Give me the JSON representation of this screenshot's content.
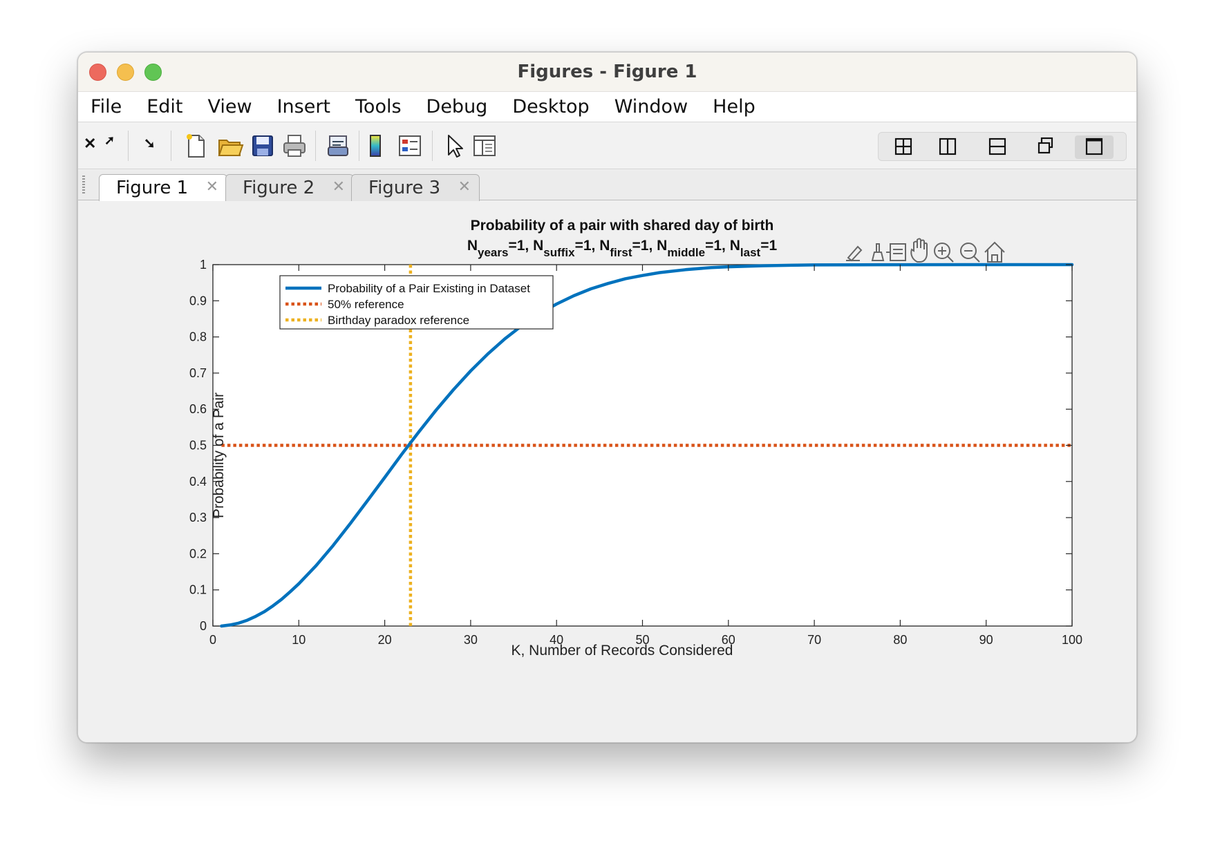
{
  "window": {
    "title": "Figures - Figure 1"
  },
  "menu": [
    "File",
    "Edit",
    "View",
    "Insert",
    "Tools",
    "Debug",
    "Desktop",
    "Window",
    "Help"
  ],
  "toolbar": {
    "close_glyph": "✕",
    "undock_glyph": "➚",
    "dock_glyph": "➘",
    "icons": [
      "new-figure-icon",
      "open-file-icon",
      "save-icon",
      "print-icon",
      "link-plot-icon",
      "colorbar-icon",
      "legend-icon",
      "pointer-icon",
      "property-inspector-icon"
    ],
    "layout_icons": [
      "tile-grid-icon",
      "tile-columns-icon",
      "tile-rows-icon",
      "float-icon",
      "maximize-icon"
    ]
  },
  "tabs": [
    {
      "label": "Figure 1",
      "active": true,
      "close": "✕"
    },
    {
      "label": "Figure 2",
      "active": false,
      "close": "✕"
    },
    {
      "label": "Figure 3",
      "active": false,
      "close": "✕"
    }
  ],
  "axes_toolbar": [
    "brush-edit-icon",
    "data-brush-icon",
    "data-tips-icon",
    "pan-hand-icon",
    "zoom-in-icon",
    "zoom-out-icon",
    "home-icon"
  ],
  "colors": {
    "curve": "#0072bd",
    "half_reference": "#d95319",
    "birthday_reference": "#edb120"
  },
  "chart_data": {
    "type": "line",
    "title": "Probability of a pair with shared day of birth",
    "subtitle_terms": [
      {
        "base": "N",
        "sub": "years",
        "suffix": "=1, "
      },
      {
        "base": "N",
        "sub": "suffix",
        "suffix": "=1, "
      },
      {
        "base": "N",
        "sub": "first",
        "suffix": "=1, "
      },
      {
        "base": "N",
        "sub": "middle",
        "suffix": "=1, "
      },
      {
        "base": "N",
        "sub": "last",
        "suffix": "=1"
      }
    ],
    "xlabel": "K, Number of Records Considered",
    "ylabel": "Probability of a Pair",
    "xlim": [
      0,
      100
    ],
    "ylim": [
      0,
      1
    ],
    "xticks": [
      0,
      10,
      20,
      30,
      40,
      50,
      60,
      70,
      80,
      90,
      100
    ],
    "yticks": [
      0,
      0.1,
      0.2,
      0.3,
      0.4,
      0.5,
      0.6,
      0.7,
      0.8,
      0.9,
      1
    ],
    "grid": true,
    "minor_grid": true,
    "legend_position": "top-left",
    "series": [
      {
        "name": "Probability of a Pair Existing in Dataset",
        "style": "solid",
        "x": [
          1,
          2,
          3,
          4,
          5,
          6,
          7,
          8,
          9,
          10,
          12,
          14,
          16,
          18,
          20,
          22,
          23,
          24,
          26,
          28,
          30,
          32,
          34,
          36,
          38,
          40,
          42,
          44,
          46,
          48,
          50,
          52,
          55,
          58,
          60,
          64,
          68,
          70,
          75,
          80,
          90,
          100
        ],
        "y": [
          0,
          0.003,
          0.008,
          0.016,
          0.027,
          0.04,
          0.056,
          0.074,
          0.095,
          0.117,
          0.167,
          0.223,
          0.284,
          0.347,
          0.411,
          0.476,
          0.507,
          0.538,
          0.598,
          0.654,
          0.706,
          0.753,
          0.795,
          0.832,
          0.864,
          0.891,
          0.914,
          0.933,
          0.948,
          0.961,
          0.97,
          0.978,
          0.986,
          0.992,
          0.994,
          0.997,
          0.9986,
          0.9992,
          0.9997,
          0.9999,
          1.0,
          1.0
        ]
      },
      {
        "name": "50% reference",
        "style": "dotted",
        "x": [
          1,
          100
        ],
        "y": [
          0.5,
          0.5
        ]
      },
      {
        "name": "Birthday paradox reference",
        "style": "dotted",
        "x": [
          23,
          23
        ],
        "y": [
          0,
          1
        ]
      }
    ]
  }
}
